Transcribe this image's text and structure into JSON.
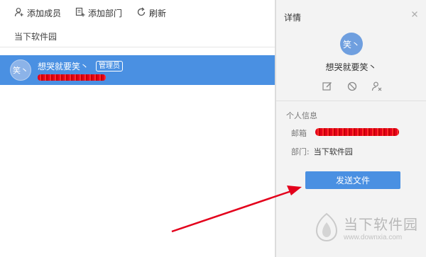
{
  "toolbar": {
    "add_member": "添加成员",
    "add_department": "添加部门",
    "refresh": "刷新"
  },
  "breadcrumb": "当下软件园",
  "member": {
    "avatar_text": "笑丶",
    "name": "想哭就要笑丶",
    "badge": "管理员"
  },
  "detail": {
    "title": "详情",
    "close_icon": "close-icon",
    "avatar_text": "笑丶",
    "name": "想哭就要笑丶",
    "section_title": "个人信息",
    "email_label": "邮箱",
    "dept_label": "部门:",
    "dept_value": "当下软件园",
    "send_button": "发送文件"
  },
  "watermark": {
    "name": "当下软件园",
    "url": "www.downxia.com"
  },
  "colors": {
    "accent": "#4a90e2",
    "arrow": "#e3001b",
    "panel": "#f3f3f3"
  }
}
